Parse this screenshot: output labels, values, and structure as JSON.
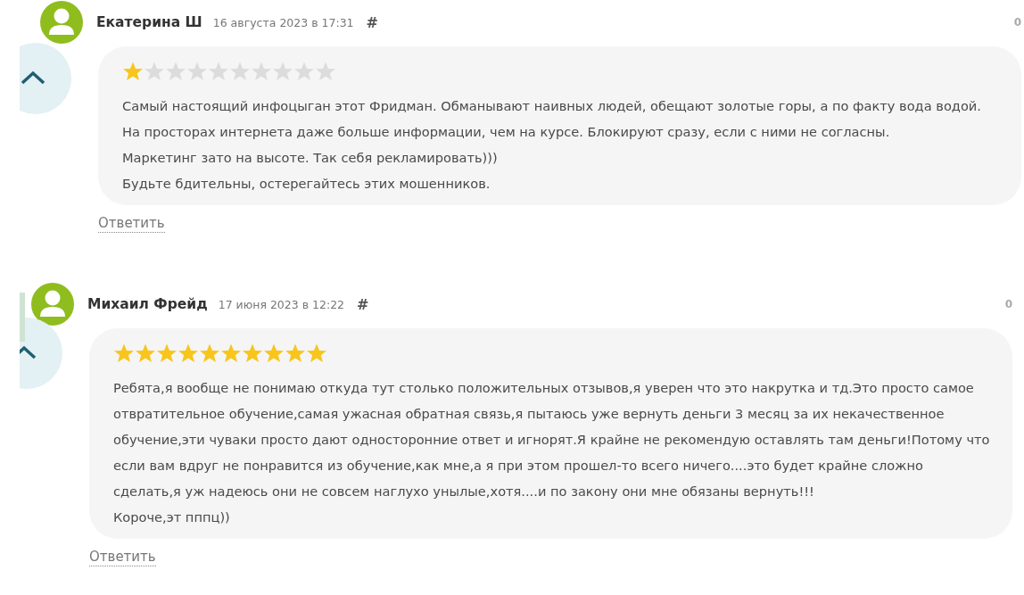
{
  "comments": [
    {
      "author": "Екатерина Ш",
      "date": "16 августа 2023 в 17:31",
      "anchor": "#",
      "votes": "0",
      "stars": 1,
      "paragraphs": [
        "Самый настоящий инфоцыган этот Фридман. Обманывают наивных людей, обещают золотые горы, а по факту вода водой. На просторах интернета даже больше информации, чем на курсе. Блокируют сразу, если с ними не согласны.",
        "Маркетинг зато на высоте. Так себя рекламировать)))",
        "Будьте бдительны, остерегайтесь этих мошенников."
      ],
      "reply": "Ответить"
    },
    {
      "author": "Михаил Фрейд",
      "date": "17 июня 2023 в 12:22",
      "anchor": "#",
      "votes": "0",
      "stars": 10,
      "paragraphs": [
        "Ребята,я вообще не понимаю откуда тут столько положительных отзывов,я уверен что это накрутка и тд.Это просто самое отвратительное обучение,самая ужасная обратная связь,я пытаюсь уже вернуть деньги 3 месяц за их некачественное обучение,эти чуваки просто дают односторонние ответ и игнорят.Я крайне не рекомендую оставлять там деньги!Потому что если вам вдруг не понравится из обучение,как мне,а я при этом прошел-то всего ничего....это будет крайне сложно сделать,я уж надеюсь они не совсем наглухо унылые,хотя....и по закону они мне обязаны вернуть!!!",
        "Короче,эт пппц))"
      ],
      "reply": "Ответить"
    }
  ]
}
